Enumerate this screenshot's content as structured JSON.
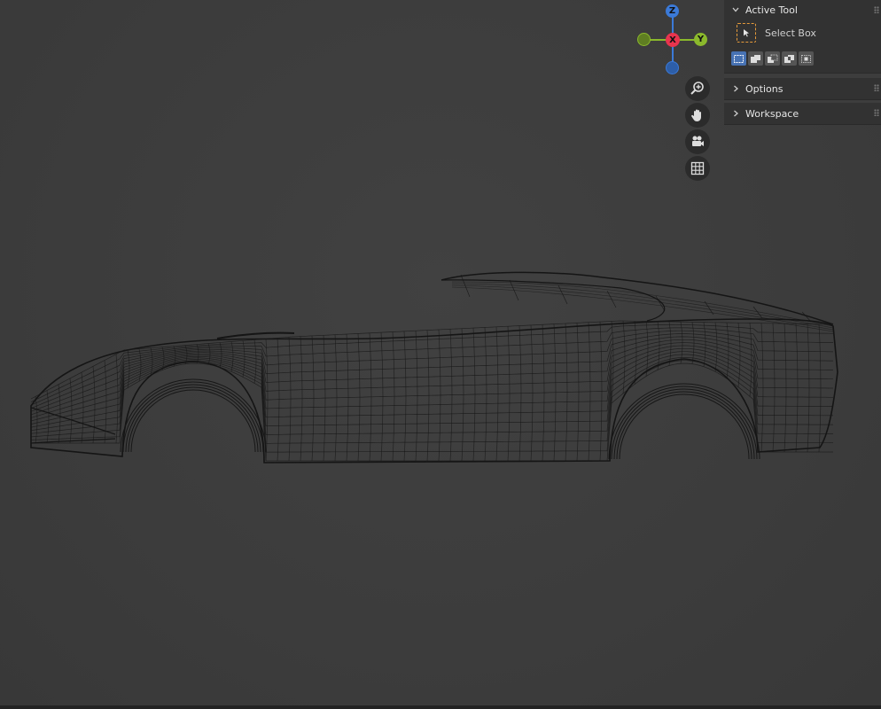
{
  "viewport": {
    "background": "#3d3d3d",
    "object": "car-body-wireframe"
  },
  "gizmo": {
    "z_label": "Z",
    "x_label": "X",
    "y_label": "Y",
    "colors": {
      "x": "#e8344e",
      "y": "#8bb92c",
      "z": "#3b7ad8"
    }
  },
  "nav_buttons": [
    {
      "name": "zoom-icon"
    },
    {
      "name": "pan-hand-icon"
    },
    {
      "name": "camera-icon"
    },
    {
      "name": "grid-icon"
    }
  ],
  "sidebar": {
    "active_tool": {
      "title": "Active Tool",
      "tool_name": "Select Box",
      "selection_modes": [
        "set",
        "extend",
        "subtract",
        "invert",
        "intersect"
      ],
      "active_mode": "set"
    },
    "options": {
      "title": "Options"
    },
    "workspace": {
      "title": "Workspace"
    }
  },
  "colors": {
    "accent": "#4772b3",
    "tool_outline": "#e59a3b",
    "panel": "#323232"
  }
}
